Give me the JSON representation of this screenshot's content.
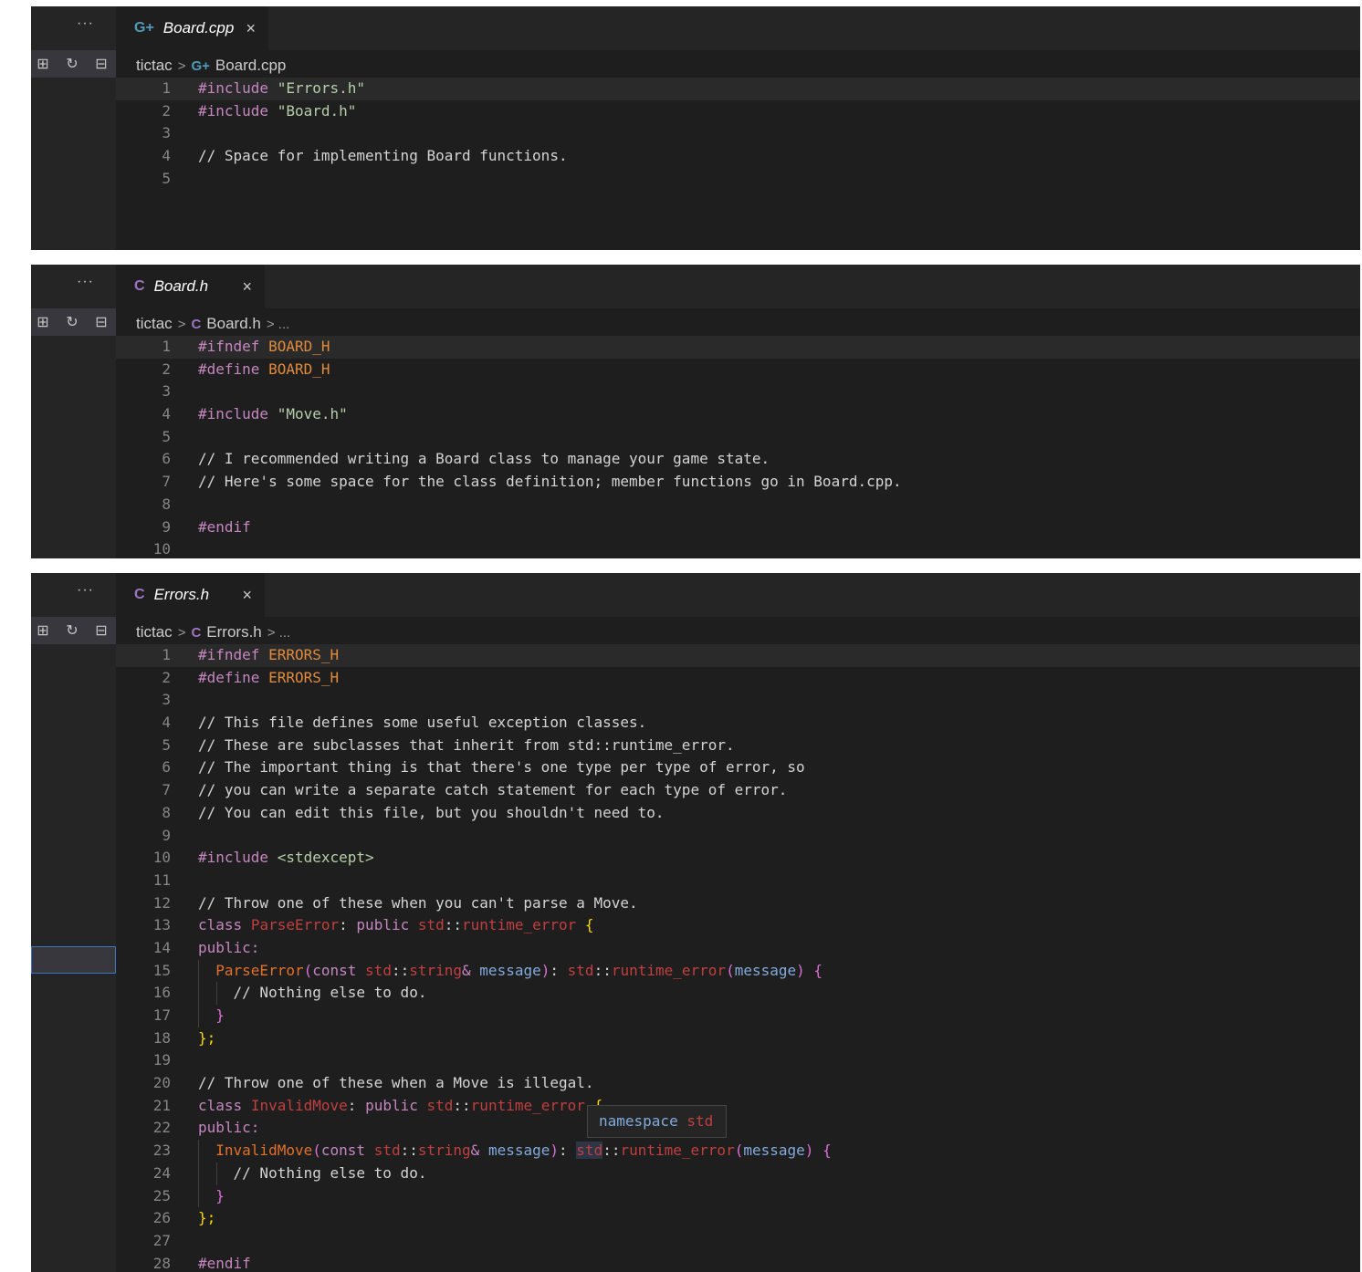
{
  "colors": {
    "editor_bg": "#1e1e1e",
    "sidebar_bg": "#252526",
    "cpp_icon": "#519aba",
    "h_icon": "#a074c4"
  },
  "panels": [
    {
      "more_label": "···",
      "icons": [
        "new-folder-icon",
        "refresh-icon",
        "collapse-icon"
      ],
      "tab": {
        "icon": "G+",
        "filename": "Board.cpp",
        "close": "×"
      },
      "breadcrumb": {
        "folder": "tictac",
        "sep": ">",
        "icon": "G+",
        "file": "Board.cpp",
        "more": ""
      },
      "lines": [
        {
          "n": "1",
          "t": "#include \"Errors.h\""
        },
        {
          "n": "2",
          "t": "#include \"Board.h\""
        },
        {
          "n": "3",
          "t": ""
        },
        {
          "n": "4",
          "t": "// Space for implementing Board functions."
        },
        {
          "n": "5",
          "t": ""
        }
      ]
    },
    {
      "more_label": "···",
      "icons": [
        "new-folder-icon",
        "refresh-icon",
        "collapse-icon"
      ],
      "tab": {
        "icon": "C",
        "filename": "Board.h",
        "close": "×"
      },
      "breadcrumb": {
        "folder": "tictac",
        "sep": ">",
        "icon": "C",
        "file": "Board.h",
        "more": "> ..."
      },
      "lines": [
        {
          "n": "1",
          "t": "#ifndef BOARD_H"
        },
        {
          "n": "2",
          "t": "#define BOARD_H"
        },
        {
          "n": "3",
          "t": ""
        },
        {
          "n": "4",
          "t": "#include \"Move.h\""
        },
        {
          "n": "5",
          "t": ""
        },
        {
          "n": "6",
          "t": "// I recommended writing a Board class to manage your game state."
        },
        {
          "n": "7",
          "t": "// Here's some space for the class definition; member functions go in Board.cpp."
        },
        {
          "n": "8",
          "t": ""
        },
        {
          "n": "9",
          "t": "#endif"
        },
        {
          "n": "10",
          "t": ""
        }
      ]
    },
    {
      "more_label": "···",
      "icons": [
        "new-folder-icon",
        "refresh-icon",
        "collapse-icon"
      ],
      "tab": {
        "icon": "C",
        "filename": "Errors.h",
        "close": "×"
      },
      "breadcrumb": {
        "folder": "tictac",
        "sep": ">",
        "icon": "C",
        "file": "Errors.h",
        "more": "> ..."
      },
      "lines": [
        {
          "n": "1",
          "t": "#ifndef ERRORS_H"
        },
        {
          "n": "2",
          "t": "#define ERRORS_H"
        },
        {
          "n": "3",
          "t": ""
        },
        {
          "n": "4",
          "t": "// This file defines some useful exception classes."
        },
        {
          "n": "5",
          "t": "// These are subclasses that inherit from std::runtime_error."
        },
        {
          "n": "6",
          "t": "// The important thing is that there's one type per type of error, so"
        },
        {
          "n": "7",
          "t": "// you can write a separate catch statement for each type of error."
        },
        {
          "n": "8",
          "t": "// You can edit this file, but you shouldn't need to."
        },
        {
          "n": "9",
          "t": ""
        },
        {
          "n": "10",
          "t": "#include <stdexcept>"
        },
        {
          "n": "11",
          "t": ""
        },
        {
          "n": "12",
          "t": "// Throw one of these when you can't parse a Move."
        },
        {
          "n": "13",
          "t": "class ParseError: public std::runtime_error {"
        },
        {
          "n": "14",
          "t": "public:"
        },
        {
          "n": "15",
          "t": "  ParseError(const std::string& message): std::runtime_error(message) {"
        },
        {
          "n": "16",
          "t": "    // Nothing else to do."
        },
        {
          "n": "17",
          "t": "  }"
        },
        {
          "n": "18",
          "t": "};"
        },
        {
          "n": "19",
          "t": ""
        },
        {
          "n": "20",
          "t": "// Throw one of these when a Move is illegal."
        },
        {
          "n": "21",
          "t": "class InvalidMove: public std::runtime_error {"
        },
        {
          "n": "22",
          "t": "public:"
        },
        {
          "n": "23",
          "t": "  InvalidMove(const std::string& message): std::runtime_error(message) {"
        },
        {
          "n": "24",
          "t": "    // Nothing else to do."
        },
        {
          "n": "25",
          "t": "  }"
        },
        {
          "n": "26",
          "t": "};"
        },
        {
          "n": "27",
          "t": ""
        },
        {
          "n": "28",
          "t": "#endif"
        }
      ],
      "hover": {
        "keyword": "namespace",
        "name": "std"
      }
    }
  ]
}
